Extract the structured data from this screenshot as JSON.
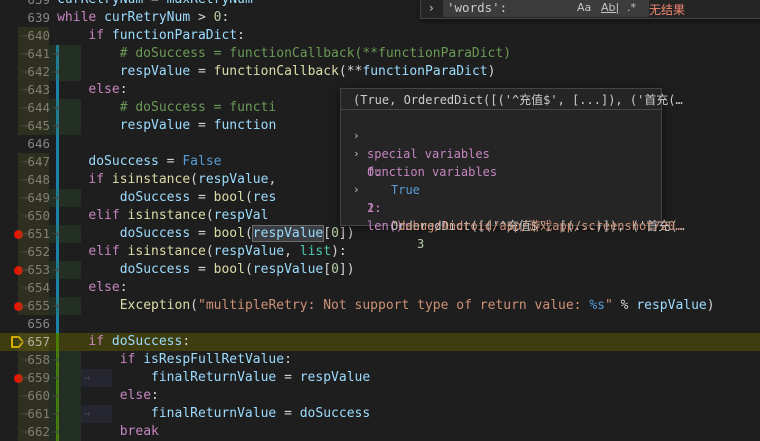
{
  "find": {
    "query": "'words':",
    "match_case": "Aa",
    "whole_word": "Ab|",
    "regex": ".*",
    "result": "无结果"
  },
  "lines": [
    {
      "num": "639",
      "text": "    curRetryNum = maxRetryNum"
    },
    {
      "num": "639",
      "text": "    while curRetryNum > 0:"
    },
    {
      "num": "640",
      "text": "        if functionParaDict:"
    },
    {
      "num": "641",
      "text": "            # doSuccess = functionCallback(**functionParaDict)"
    },
    {
      "num": "642",
      "text": "            respValue = functionCallback(**functionParaDict)"
    },
    {
      "num": "643",
      "text": "        else:"
    },
    {
      "num": "644",
      "text": "            # doSuccess = functi"
    },
    {
      "num": "645",
      "text": "            respValue = function"
    },
    {
      "num": "646",
      "text": ""
    },
    {
      "num": "647",
      "text": "        doSuccess = False"
    },
    {
      "num": "648",
      "text": "        if isinstance(respValue,"
    },
    {
      "num": "649",
      "text": "            doSuccess = bool(res"
    },
    {
      "num": "650",
      "text": "        elif isinstance(respVal"
    },
    {
      "num": "651",
      "text": "            doSuccess = bool(respValue[0])"
    },
    {
      "num": "652",
      "text": "        elif isinstance(respValue, list):"
    },
    {
      "num": "653",
      "text": "            doSuccess = bool(respValue[0])"
    },
    {
      "num": "654",
      "text": "        else:"
    },
    {
      "num": "655",
      "text": "            Exception(\"multipleRetry: Not support type of return value: %s\" % respValue)"
    },
    {
      "num": "656",
      "text": ""
    },
    {
      "num": "657",
      "text": "        if doSuccess:"
    },
    {
      "num": "658",
      "text": "            if isRespFullRetValue:"
    },
    {
      "num": "659",
      "text": "                finalReturnValue = respValue"
    },
    {
      "num": "660",
      "text": "            else:"
    },
    {
      "num": "661",
      "text": "                finalReturnValue = doSuccess"
    },
    {
      "num": "662",
      "text": "            break"
    }
  ],
  "hover": {
    "title": "(True, OrderedDict([('^充值$', [...]), ('首充(…",
    "special_label": "special variables",
    "function_label": "function variables",
    "items": [
      {
        "key": "0:",
        "value": "True"
      },
      {
        "key": "1:",
        "value": "OrderedDict([('^充值$', [(...)]), ('首充(…"
      },
      {
        "key": "2:",
        "value": "'debug/Android/app/游戏app/screenshot/20…"
      }
    ],
    "len_label": "len():",
    "len_value": "3"
  },
  "colors": {
    "background": "#1e1e1e",
    "breakpoint": "#e51400",
    "current_line": "#3d3d10",
    "keyword": "#569cd6",
    "control": "#c586c0",
    "function": "#dcdcaa",
    "variable": "#9cdcfe",
    "comment": "#6a9955",
    "string": "#ce9178"
  }
}
